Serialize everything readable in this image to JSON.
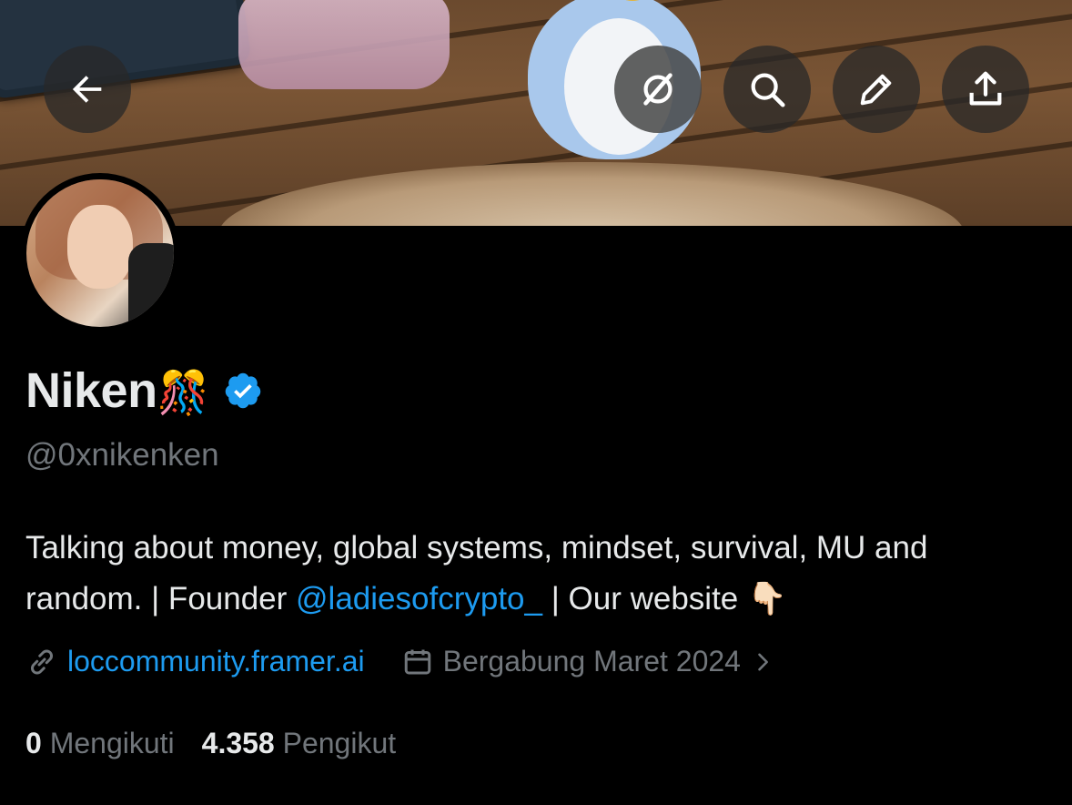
{
  "profile": {
    "display_name": "Niken",
    "name_emoji": "🎊",
    "handle": "@0xnikenken",
    "bio_part1": "Talking about money, global systems, mindset, survival, MU and random. | Founder ",
    "bio_mention": "@ladiesofcrypto_",
    "bio_part2": " | Our website ",
    "bio_emoji": "👇🏻",
    "website": "loccommunity.framer.ai",
    "joined": "Bergabung Maret 2024",
    "following_count": "0",
    "following_label": "Mengikuti",
    "followers_count": "4.358",
    "followers_label": "Pengikut"
  },
  "header": {
    "icons": [
      "back-arrow-icon",
      "grok-icon",
      "search-icon",
      "edit-pencil-icon",
      "share-icon"
    ]
  },
  "colors": {
    "background": "#000000",
    "accent": "#1d9bf0",
    "secondary_text": "#71767b",
    "primary_text": "#e7e9ea"
  }
}
